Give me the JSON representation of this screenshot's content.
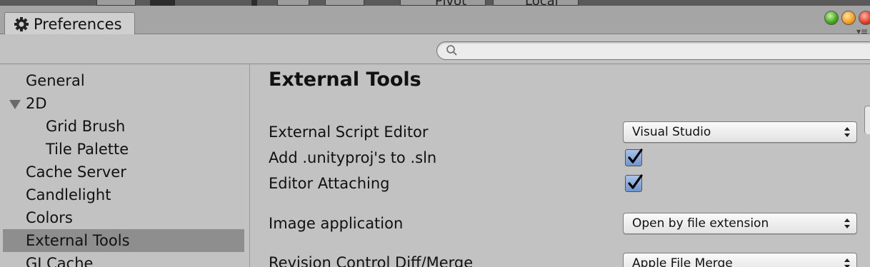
{
  "top_strip": {
    "pivot_label": "Pivot",
    "local_label": "Local"
  },
  "tab": {
    "label": "Preferences",
    "icon": "gear-icon"
  },
  "search": {
    "placeholder": "",
    "value": ""
  },
  "sidebar": {
    "items": [
      {
        "label": "General",
        "level": 0,
        "selected": false
      },
      {
        "label": "2D",
        "level": 0,
        "expanded": true,
        "selected": false
      },
      {
        "label": "Grid Brush",
        "level": 1,
        "selected": false
      },
      {
        "label": "Tile Palette",
        "level": 1,
        "selected": false
      },
      {
        "label": "Cache Server",
        "level": 0,
        "selected": false
      },
      {
        "label": "Candlelight",
        "level": 0,
        "selected": false
      },
      {
        "label": "Colors",
        "level": 0,
        "selected": false
      },
      {
        "label": "External Tools",
        "level": 0,
        "selected": true
      },
      {
        "label": "GI Cache",
        "level": 0,
        "selected": false
      }
    ]
  },
  "content": {
    "title": "External Tools",
    "external_script_editor": {
      "label": "External Script Editor",
      "value": "Visual Studio"
    },
    "add_unityproj": {
      "label": "Add .unityproj's to .sln",
      "checked": true
    },
    "editor_attaching": {
      "label": "Editor Attaching",
      "checked": true
    },
    "image_application": {
      "label": "Image application",
      "value": "Open by file extension"
    },
    "revision_control": {
      "label": "Revision Control Diff/Merge",
      "value": "Apple File Merge"
    }
  },
  "colors": {
    "selected_row": "#8e8e8e",
    "checkbox_fill": "#7fa2d6",
    "background": "#c2c2c2"
  }
}
